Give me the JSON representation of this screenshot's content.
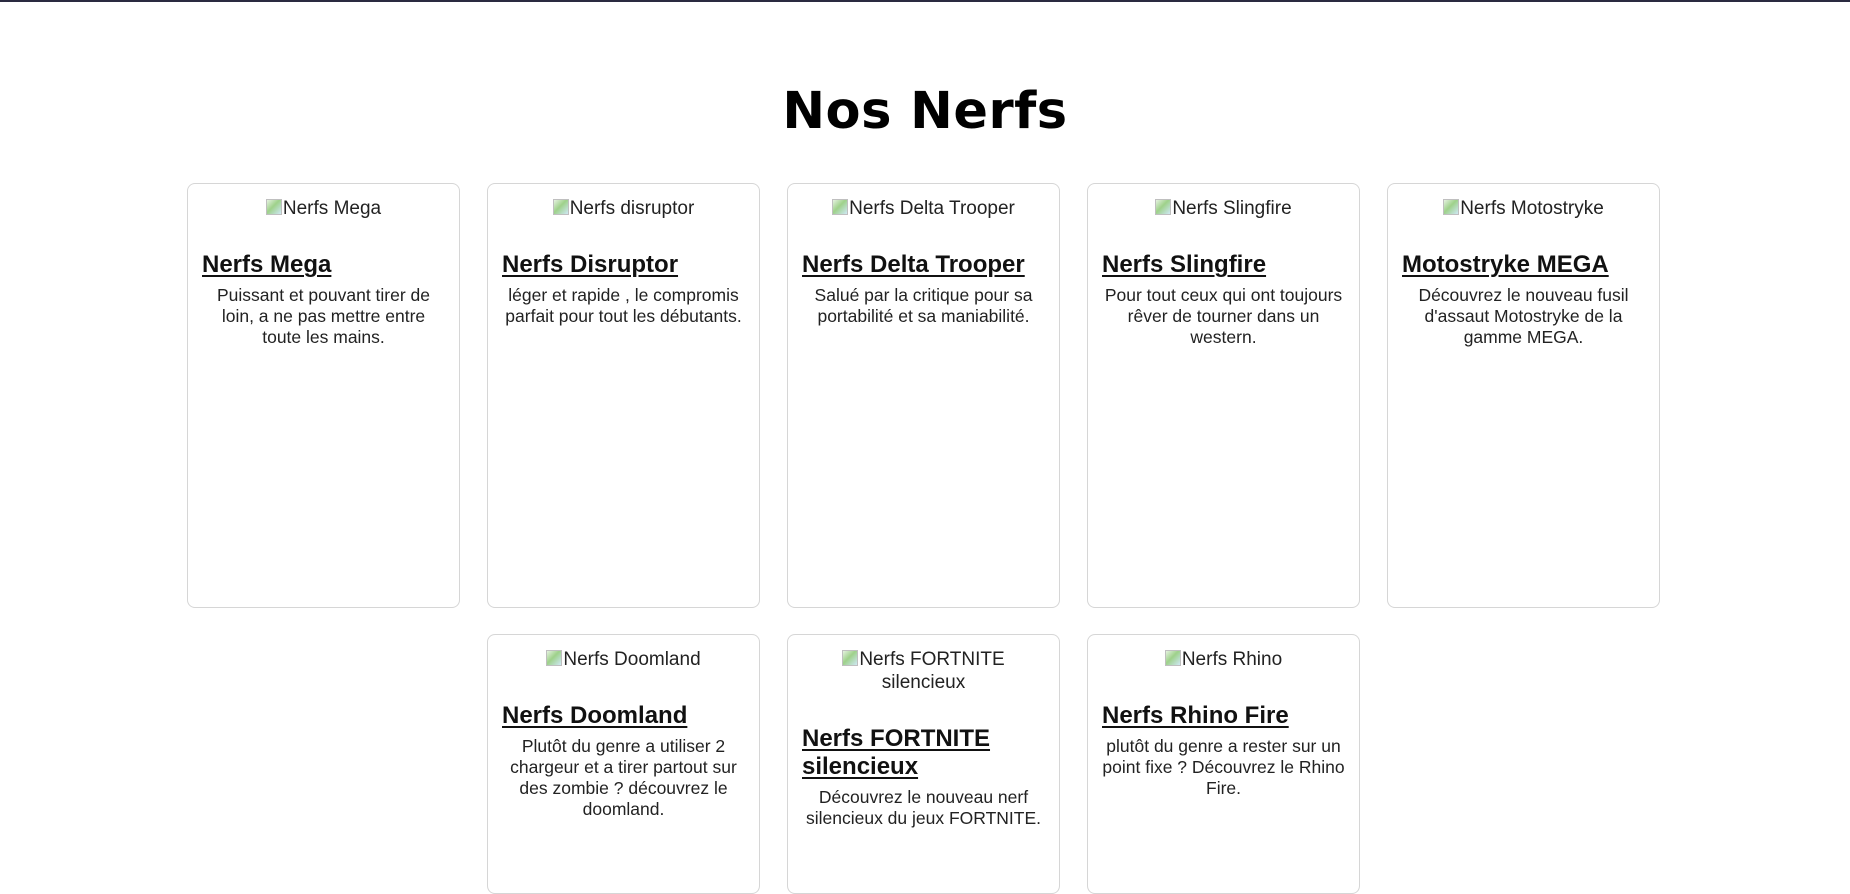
{
  "page": {
    "title": "Nos Nerfs"
  },
  "cards": [
    {
      "img_alt": "Nerfs Mega",
      "title": "Nerfs Mega",
      "description": "Puissant et pouvant tirer de loin, a ne pas mettre entre toute les mains."
    },
    {
      "img_alt": "Nerfs disruptor",
      "title": "Nerfs Disruptor",
      "description": "léger et rapide , le compromis parfait pour tout les débutants."
    },
    {
      "img_alt": "Nerfs Delta Trooper",
      "title": "Nerfs Delta Trooper",
      "description": "Salué par la critique pour sa portabilité et sa maniabilité."
    },
    {
      "img_alt": "Nerfs Slingfire",
      "title": "Nerfs Slingfire",
      "description": "Pour tout ceux qui ont toujours rêver de tourner dans un western."
    },
    {
      "img_alt": "Nerfs Motostryke",
      "title": "Motostryke MEGA",
      "description": "Découvrez le nouveau fusil d'assaut Motostryke de la gamme MEGA."
    },
    {
      "img_alt": "Nerfs Doomland",
      "title": "Nerfs Doomland",
      "description": "Plutôt du genre a utiliser 2 chargeur et a tirer partout sur des zombie ? découvrez le doomland."
    },
    {
      "img_alt": "Nerfs FORTNITE silencieux",
      "title": "Nerfs FORTNITE silencieux",
      "description": "Découvrez le nouveau nerf silencieux du jeux FORTNITE."
    },
    {
      "img_alt": "Nerfs Rhino",
      "title": "Nerfs Rhino Fire",
      "description": "plutôt du genre a rester sur un point fixe ? Découvrez le Rhino Fire."
    }
  ]
}
